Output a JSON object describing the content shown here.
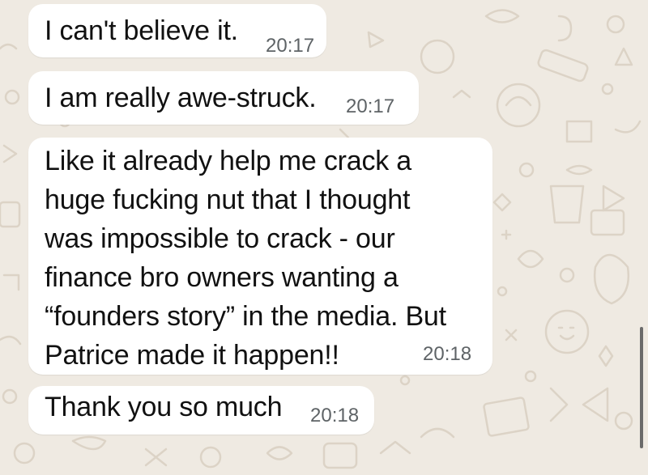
{
  "chat": {
    "messages": [
      {
        "text": "I can't believe it.",
        "time": "20:17"
      },
      {
        "text": "I am really awe-struck.",
        "time": "20:17"
      },
      {
        "text": "Like it already help me crack a\nhuge fucking nut that I thought\nwas impossible to crack - our\nfinance bro owners wanting a\n“founders story” in the media. But\nPatrice made it happen!!",
        "time": "20:18"
      },
      {
        "text": "Thank you so much",
        "time": "20:18"
      }
    ]
  },
  "theme": {
    "wallpaper_color": "#efeae2",
    "bubble_color": "#ffffff",
    "timestamp_color": "#5e6366"
  }
}
